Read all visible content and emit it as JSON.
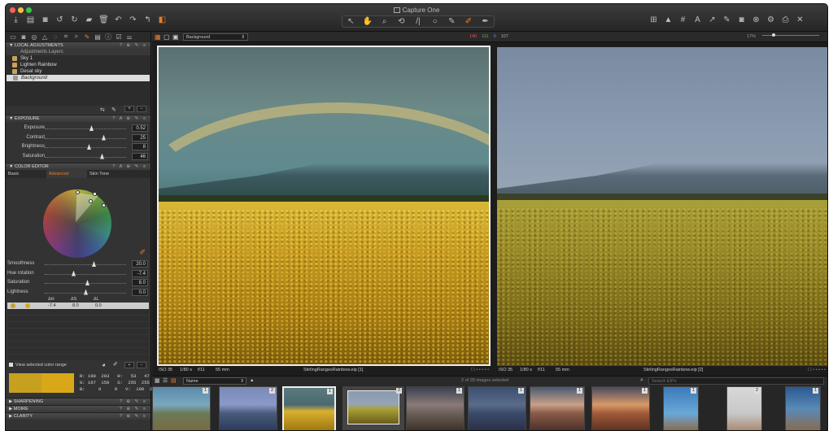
{
  "window": {
    "title": "Capture One"
  },
  "toolbar": {
    "cursor_tools": [
      "cursor-tool",
      "pan-tool",
      "zoom-tool",
      "rotate-tool",
      "straighten-tool",
      "crop-tool",
      "picker-tool",
      "brush-tool"
    ]
  },
  "readout": {
    "r": "140",
    "g": "111",
    "b": "0",
    "k": "107"
  },
  "variant_selector": {
    "value": "Background"
  },
  "local_adjustments": {
    "title": "LOCAL ADJUSTMENTS",
    "header": "Adjustments Layers",
    "layers": [
      {
        "label": "Sky 1"
      },
      {
        "label": "Lighten Rainbow"
      },
      {
        "label": "Desat sky"
      },
      {
        "label": "Background"
      }
    ]
  },
  "exposure": {
    "title": "EXPOSURE",
    "rows": [
      {
        "label": "Exposure",
        "value": "0.52",
        "pos": 0.55
      },
      {
        "label": "Contrast",
        "value": "25",
        "pos": 0.7
      },
      {
        "label": "Brightness",
        "value": "8",
        "pos": 0.52
      },
      {
        "label": "Saturation",
        "value": "46",
        "pos": 0.68
      }
    ]
  },
  "color_editor": {
    "title": "COLOR EDITOR",
    "tabs": [
      "Basic",
      "Advanced",
      "Skin Tone"
    ],
    "rows": [
      {
        "label": "Smoothness",
        "value": "20.0",
        "pos": 0.6
      },
      {
        "label": "Hue rotation",
        "value": "-7.4",
        "pos": 0.35
      },
      {
        "label": "Saturation",
        "value": "8.0",
        "pos": 0.52
      },
      {
        "label": "Lightness",
        "value": "0.0",
        "pos": 0.5
      }
    ],
    "delta_headers": [
      "ΔH",
      "ΔS",
      "ΔL"
    ],
    "delta_values": [
      "-7.4",
      "8.0",
      "0.0"
    ],
    "view_selected": "View selected color range",
    "rgb": {
      "r": "R: 190  203   H:   53   47",
      "g": "G: 167  159   S:  255  255",
      "b": "B:     0     0   V:  190  203"
    }
  },
  "bottom_sections": [
    "SHARPENING",
    "MOIRE",
    "CLARITY"
  ],
  "viewer": {
    "left": {
      "iso": "ISO 35",
      "shutter": "1/80 s",
      "aperture": "f/11",
      "focal": "55 mm",
      "name": "StirlingRangesRainbow.eip [1]"
    },
    "right": {
      "iso": "ISO 35",
      "shutter": "1/80 s",
      "aperture": "f/11",
      "focal": "55 mm",
      "name": "StirlingRangesRainbow.eip [2]"
    }
  },
  "browser": {
    "sort": "Name",
    "count": "2 of 28 images selected",
    "search_placeholder": "Search EIPs",
    "thumb_numbers": [
      "1",
      "2",
      "1",
      "2",
      "1",
      "1",
      "1",
      "1",
      "1",
      "2",
      "1"
    ]
  },
  "zoom": {
    "value": "17%"
  }
}
